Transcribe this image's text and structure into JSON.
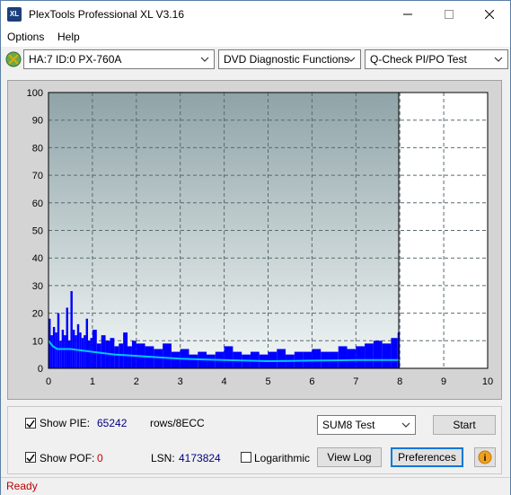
{
  "window": {
    "title": "PlexTools Professional XL V3.16",
    "icon_label": "XL"
  },
  "menu": {
    "options": "Options",
    "help": "Help"
  },
  "toolbar": {
    "drive": "HA:7 ID:0  PX-760A",
    "function": "DVD Diagnostic Functions",
    "test": "Q-Check PI/PO Test"
  },
  "chart": {
    "y_ticks": [
      "100",
      "90",
      "80",
      "70",
      "60",
      "50",
      "40",
      "30",
      "20",
      "10",
      "0"
    ],
    "x_ticks": [
      "0",
      "1",
      "2",
      "3",
      "4",
      "5",
      "6",
      "7",
      "8",
      "9",
      "10"
    ]
  },
  "chart_data": {
    "type": "bar",
    "xlim": [
      0,
      10
    ],
    "ylim": [
      0,
      100
    ],
    "grid": true,
    "data_end_x": 8.0,
    "series": [
      {
        "type": "bar",
        "color": "#0000ff",
        "x": [
          0.0,
          0.05,
          0.1,
          0.15,
          0.2,
          0.25,
          0.3,
          0.35,
          0.4,
          0.45,
          0.5,
          0.55,
          0.6,
          0.65,
          0.7,
          0.75,
          0.8,
          0.85,
          0.9,
          0.95,
          1.0,
          1.1,
          1.2,
          1.3,
          1.4,
          1.5,
          1.6,
          1.7,
          1.8,
          1.9,
          2.0,
          2.2,
          2.4,
          2.6,
          2.8,
          3.0,
          3.2,
          3.4,
          3.6,
          3.8,
          4.0,
          4.2,
          4.4,
          4.6,
          4.8,
          5.0,
          5.2,
          5.4,
          5.6,
          5.8,
          6.0,
          6.2,
          6.4,
          6.6,
          6.8,
          7.0,
          7.2,
          7.4,
          7.6,
          7.8,
          7.95
        ],
        "values": [
          18,
          12,
          15,
          13,
          20,
          10,
          14,
          12,
          22,
          10,
          28,
          14,
          12,
          16,
          13,
          11,
          12,
          18,
          10,
          11,
          14,
          9,
          12,
          10,
          11,
          8,
          9,
          13,
          8,
          10,
          9,
          8,
          7,
          9,
          6,
          7,
          5,
          6,
          5,
          6,
          8,
          6,
          5,
          6,
          5,
          6,
          7,
          5,
          6,
          6,
          7,
          6,
          6,
          8,
          7,
          8,
          9,
          10,
          9,
          11,
          13
        ]
      },
      {
        "type": "line",
        "color": "#00c8ff",
        "x": [
          0.0,
          0.1,
          0.2,
          0.5,
          1.0,
          1.5,
          2.0,
          2.5,
          3.0,
          3.5,
          4.0,
          4.5,
          5.0,
          5.5,
          6.0,
          6.5,
          7.0,
          7.5,
          8.0
        ],
        "values": [
          10,
          8,
          7,
          7,
          6,
          5,
          4.5,
          4,
          3.5,
          3.2,
          3,
          2.8,
          2.6,
          2.7,
          2.8,
          2.9,
          3,
          3,
          3
        ]
      }
    ]
  },
  "controls": {
    "show_pie_label": "Show PIE:",
    "pie_value": "65242",
    "pie_unit": "rows/8ECC",
    "show_pof_label": "Show POF:",
    "pof_value": "0",
    "lsn_label": "LSN:",
    "lsn_value": "4173824",
    "log_label": "Logarithmic",
    "test_select": "SUM8 Test",
    "start": "Start",
    "view_log": "View Log",
    "preferences": "Preferences",
    "info_icon": "i"
  },
  "status": {
    "text": "Ready"
  },
  "colors": {
    "pie_value": "#000080",
    "pof_value": "#c00000",
    "status_text": "#c00000",
    "bar": "#0000ff",
    "line": "#00c8ff"
  }
}
